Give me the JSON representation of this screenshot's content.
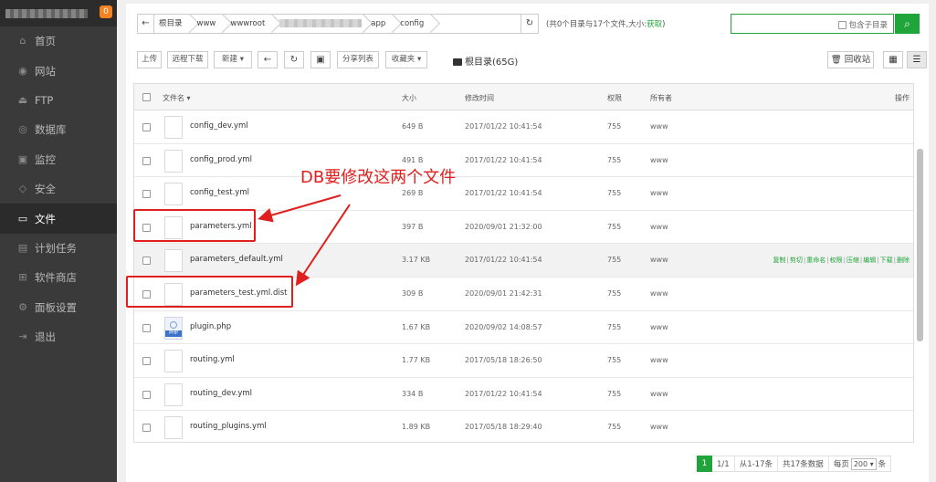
{
  "sidebar": {
    "badge": "0",
    "items": [
      {
        "label": "首页",
        "icon": "home-icon",
        "glyph": "⌂"
      },
      {
        "label": "网站",
        "icon": "globe-icon",
        "glyph": "◉"
      },
      {
        "label": "FTP",
        "icon": "ftp-icon",
        "glyph": "⏏"
      },
      {
        "label": "数据库",
        "icon": "database-icon",
        "glyph": "◎"
      },
      {
        "label": "监控",
        "icon": "monitor-icon",
        "glyph": "▣"
      },
      {
        "label": "安全",
        "icon": "shield-icon",
        "glyph": "◇"
      },
      {
        "label": "文件",
        "icon": "folder-icon",
        "glyph": "▭"
      },
      {
        "label": "计划任务",
        "icon": "calendar-icon",
        "glyph": "▤"
      },
      {
        "label": "软件商店",
        "icon": "apps-icon",
        "glyph": "⊞"
      },
      {
        "label": "面板设置",
        "icon": "settings-icon",
        "glyph": "⚙"
      },
      {
        "label": "退出",
        "icon": "logout-icon",
        "glyph": "⇥"
      }
    ],
    "active_index": 6
  },
  "breadcrumb": {
    "back_icon": "arrow-left-icon",
    "crumbs": [
      "根目录",
      "www",
      "wwwroot",
      "",
      "app",
      "config"
    ],
    "refresh_icon": "refresh-icon"
  },
  "summary": {
    "text": "(共0个目录与17个文件,大小:",
    "link": "获取",
    "close": ")"
  },
  "search": {
    "include_subdir": "包含子目录",
    "search_icon": "search-icon"
  },
  "toolbar": {
    "upload": "上传",
    "remote_download": "远程下载",
    "new": "新建 ▾",
    "back_icon": "arrow-left-icon",
    "refresh_icon": "refresh-icon",
    "terminal_icon": "terminal-icon",
    "share_list": "分享列表",
    "favorites": "收藏夹 ▾",
    "root_dir": "根目录(65G)",
    "recycle": "回收站",
    "grid_icon": "grid-view-icon",
    "list_icon": "list-view-icon"
  },
  "table": {
    "headers": {
      "name": "文件名 ▾",
      "size": "大小",
      "mtime": "修改时间",
      "perm": "权限",
      "owner": "所有者",
      "ops": "操作"
    },
    "rows": [
      {
        "name": "config_dev.yml",
        "size": "649 B",
        "mtime": "2017/01/22 10:41:54",
        "perm": "755",
        "owner": "www"
      },
      {
        "name": "config_prod.yml",
        "size": "491 B",
        "mtime": "2017/01/22 10:41:54",
        "perm": "755",
        "owner": "www"
      },
      {
        "name": "config_test.yml",
        "size": "269 B",
        "mtime": "2017/01/22 10:41:54",
        "perm": "755",
        "owner": "www"
      },
      {
        "name": "parameters.yml",
        "size": "397 B",
        "mtime": "2020/09/01 21:32:00",
        "perm": "755",
        "owner": "www"
      },
      {
        "name": "parameters_default.yml",
        "size": "3.17 KB",
        "mtime": "2017/01/22 10:41:54",
        "perm": "755",
        "owner": "www"
      },
      {
        "name": "parameters_test.yml.dist",
        "size": "309 B",
        "mtime": "2020/09/01 21:42:31",
        "perm": "755",
        "owner": "www"
      },
      {
        "name": "plugin.php",
        "size": "1.67 KB",
        "mtime": "2020/09/02 14:08:57",
        "perm": "755",
        "owner": "www"
      },
      {
        "name": "routing.yml",
        "size": "1.77 KB",
        "mtime": "2017/05/18 18:26:50",
        "perm": "755",
        "owner": "www"
      },
      {
        "name": "routing_dev.yml",
        "size": "334 B",
        "mtime": "2017/01/22 10:41:54",
        "perm": "755",
        "owner": "www"
      },
      {
        "name": "routing_plugins.yml",
        "size": "1.89 KB",
        "mtime": "2017/05/18 18:29:40",
        "perm": "755",
        "owner": "www"
      }
    ],
    "hover_ops": [
      "复制",
      "剪切",
      "重命名",
      "权限",
      "压缩",
      "编辑",
      "下载",
      "删除"
    ]
  },
  "pager": {
    "current": "1",
    "pages": "1/1",
    "range": "从1-17条",
    "total": "共17条数据",
    "per_page_label": "每页",
    "per_page": "200 ▾",
    "unit": "条"
  },
  "annotation": {
    "text": "DB要修改这两个文件"
  },
  "colors": {
    "accent": "#20a53a",
    "annotation": "#e0201e",
    "sidebar": "#3a3a3a",
    "badge": "#f5821f"
  }
}
